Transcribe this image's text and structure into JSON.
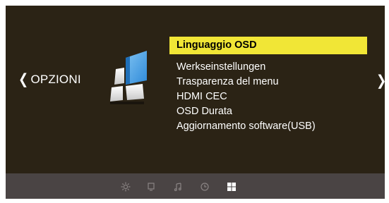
{
  "nav": {
    "left_chevron": "❮",
    "left_label": "OPZIONI",
    "right_chevron": "❯"
  },
  "section_icon": "options-settings-icon",
  "menu": {
    "items": [
      {
        "label": "Linguaggio OSD",
        "selected": true
      },
      {
        "label": "Werkseinstellungen",
        "selected": false
      },
      {
        "label": "Trasparenza del menu",
        "selected": false
      },
      {
        "label": "HDMI CEC",
        "selected": false
      },
      {
        "label": "OSD Durata",
        "selected": false
      },
      {
        "label": "Aggiornamento  software(USB)",
        "selected": false
      }
    ]
  },
  "bottom_tabs": [
    {
      "name": "picture-icon",
      "active": false
    },
    {
      "name": "screen-icon",
      "active": false
    },
    {
      "name": "music-note-icon",
      "active": false
    },
    {
      "name": "clock-icon",
      "active": false
    },
    {
      "name": "options-grid-icon",
      "active": true
    }
  ],
  "colors": {
    "background": "#2b2315",
    "highlight": "#f1e636",
    "bottom_bar": "#4a4444",
    "icon_inactive": "#8a8484",
    "icon_active": "#ffffff"
  }
}
